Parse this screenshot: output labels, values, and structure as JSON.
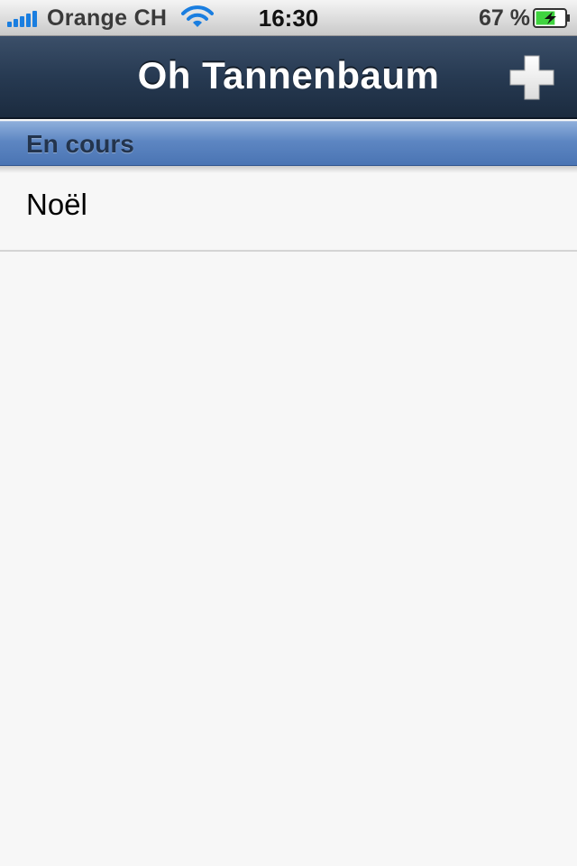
{
  "status_bar": {
    "carrier": "Orange CH",
    "time": "16:30",
    "battery_percent": "67 %",
    "battery_level": 0.67,
    "signal_icon": "signal-bars-icon",
    "wifi_icon": "wifi-icon",
    "battery_icon": "battery-charging-icon"
  },
  "nav_bar": {
    "title": "Oh Tannenbaum",
    "add_icon": "plus-icon"
  },
  "section": {
    "title": "En cours",
    "items": [
      {
        "label": "Noël"
      }
    ]
  },
  "colors": {
    "nav_bar": "#273a52",
    "section_header": "#5d86c2",
    "background": "#f7f7f7",
    "signal": "#1a7ee0",
    "battery_fill": "#3fd43f"
  }
}
